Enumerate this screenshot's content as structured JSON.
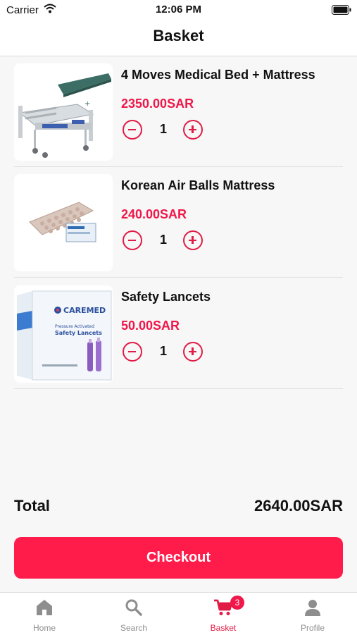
{
  "status_bar": {
    "carrier": "Carrier",
    "time": "12:06 PM"
  },
  "nav": {
    "title": "Basket"
  },
  "items": [
    {
      "name": "4 Moves Medical Bed + Mattress",
      "price": "2350.00SAR",
      "quantity": "1",
      "image": "medical-bed"
    },
    {
      "name": "Korean Air Balls Mattress",
      "price": "240.00SAR",
      "quantity": "1",
      "image": "air-mattress"
    },
    {
      "name": "Safety Lancets",
      "price": "50.00SAR",
      "quantity": "1",
      "image": "lancets-box",
      "image_text": {
        "brand": "CAREMED",
        "line1": "Pressure Activated",
        "line2": "Safety Lancets"
      }
    }
  ],
  "total": {
    "label": "Total",
    "value": "2640.00SAR"
  },
  "checkout_label": "Checkout",
  "tabs": [
    {
      "label": "Home",
      "icon": "home-icon"
    },
    {
      "label": "Search",
      "icon": "search-icon"
    },
    {
      "label": "Basket",
      "icon": "cart-icon",
      "badge": "3",
      "active": true
    },
    {
      "label": "Profile",
      "icon": "profile-icon"
    }
  ],
  "colors": {
    "accent": "#f0174a",
    "checkout": "#ff1c4b",
    "inactive_tab": "#8e8e8e"
  }
}
